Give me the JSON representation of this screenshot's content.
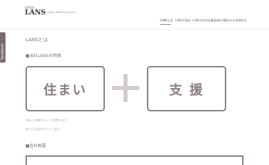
{
  "header": {
    "logo_small": "合同会社",
    "logo_main": "LANS",
    "tagline": "Life Assist Network Service",
    "nav": [
      "LANSとは",
      "LANSの強み",
      "LANSの住宅支援",
      "入居者の方へ",
      "家主の方へ",
      "お問合せ"
    ]
  },
  "side_tab": {
    "label": "Facebook"
  },
  "main": {
    "heading": "LANSとは",
    "section1_title": "■当社LANSの特徴",
    "box_left": "住まい",
    "box_right": "支 援",
    "text_line1": "住まいと支援をセットでご提供します",
    "text_line2": "安心した生活をサポートします",
    "section2_title": "■会社概要"
  },
  "colors": {
    "accent": "#8a7d7f",
    "plus": "#d2cacb",
    "side_tab": "#7a6a6e"
  }
}
